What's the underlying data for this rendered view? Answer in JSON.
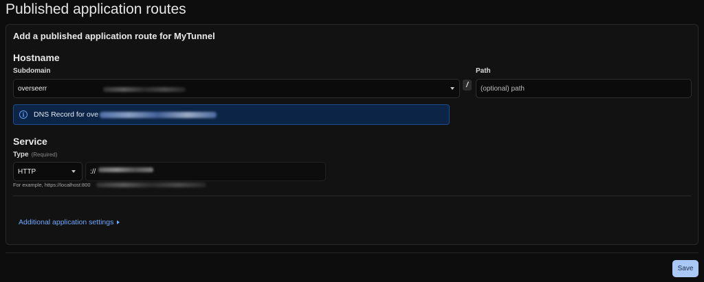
{
  "page": {
    "title": "Published application routes"
  },
  "form": {
    "title": "Add a published application route for MyTunnel",
    "hostname": {
      "section_title": "Hostname",
      "subdomain_label": "Subdomain",
      "subdomain_value": "overseerr",
      "path_label": "Path",
      "path_placeholder": "(optional) path",
      "separator": "/"
    },
    "dns_notice": {
      "icon": "info-icon",
      "text": "DNS Record for ove"
    },
    "service": {
      "section_title": "Service",
      "type_label": "Type",
      "type_required": "(Required)",
      "type_value": "HTTP",
      "url_value": "://",
      "hint": "For example, https://localhost:800"
    },
    "additional_settings_label": "Additional application settings"
  },
  "footer": {
    "save_label": "Save"
  },
  "colors": {
    "background": "#0d0d0d",
    "card": "#121212",
    "info_bg": "#0c2445",
    "link": "#6fa8ff",
    "save_button": "#a9c8f5"
  }
}
